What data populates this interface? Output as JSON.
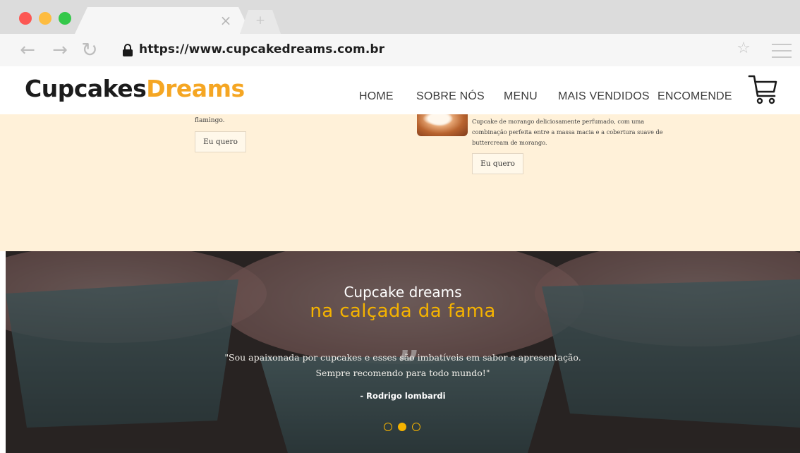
{
  "browser": {
    "url": "https://www.cupcakedreams.com.br"
  },
  "site": {
    "logo_part1": "Cupcakes",
    "logo_part2": "Dreams",
    "nav": [
      "HOME",
      "SOBRE NÓS",
      "MENU",
      "MAIS VENDIDOS",
      "ENCOMENDE"
    ]
  },
  "products": [
    {
      "description": "flamingo.",
      "button": "Eu quero"
    },
    {
      "description": "Cupcake de morango deliciosamente perfumado, com uma combinação perfeita entre a massa macia e a cobertura suave de buttercream de morango.",
      "button": "Eu quero"
    }
  ],
  "testimonial": {
    "title_line1": "Cupcake dreams",
    "title_line2": "na calçada da fama",
    "quote_line1": "\"Sou apaixonada por cupcakes e esses são imbatíveis em sabor e apresentação.",
    "quote_line2": "Sempre recomendo para todo mundo!\"",
    "author": "- Rodrigo lombardi",
    "carousel_active": 2,
    "carousel_count": 3
  },
  "colors": {
    "accent": "#f5b300",
    "logo_accent": "#f5a623",
    "products_bg": "#fff1d9"
  }
}
